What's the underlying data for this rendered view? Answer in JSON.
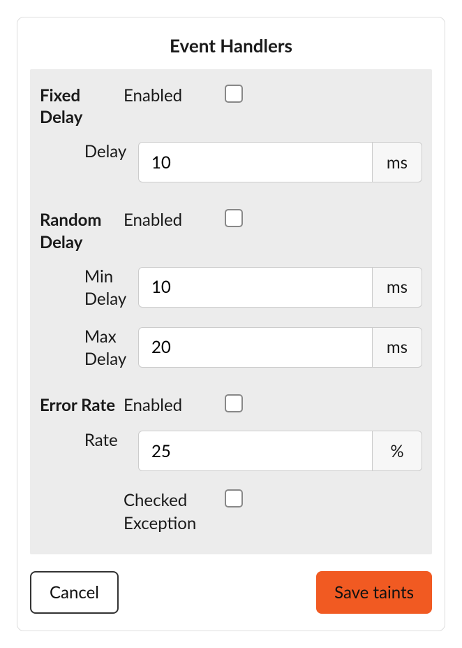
{
  "title": "Event Handlers",
  "groups": {
    "fixedDelay": {
      "label": "Fixed Delay",
      "enabledLabel": "Enabled",
      "enabled": false,
      "delayLabel": "Delay",
      "delayValue": "10",
      "delayUnit": "ms"
    },
    "randomDelay": {
      "label": "Random Delay",
      "enabledLabel": "Enabled",
      "enabled": false,
      "minDelayLabel": "Min Delay",
      "minDelayValue": "10",
      "minDelayUnit": "ms",
      "maxDelayLabel": "Max Delay",
      "maxDelayValue": "20",
      "maxDelayUnit": "ms"
    },
    "errorRate": {
      "label": "Error Rate",
      "enabledLabel": "Enabled",
      "enabled": false,
      "rateLabel": "Rate",
      "rateValue": "25",
      "rateUnit": "%",
      "checkedExceptionLabel": "Checked Exception",
      "checkedException": false
    }
  },
  "buttons": {
    "cancel": "Cancel",
    "save": "Save taints"
  }
}
